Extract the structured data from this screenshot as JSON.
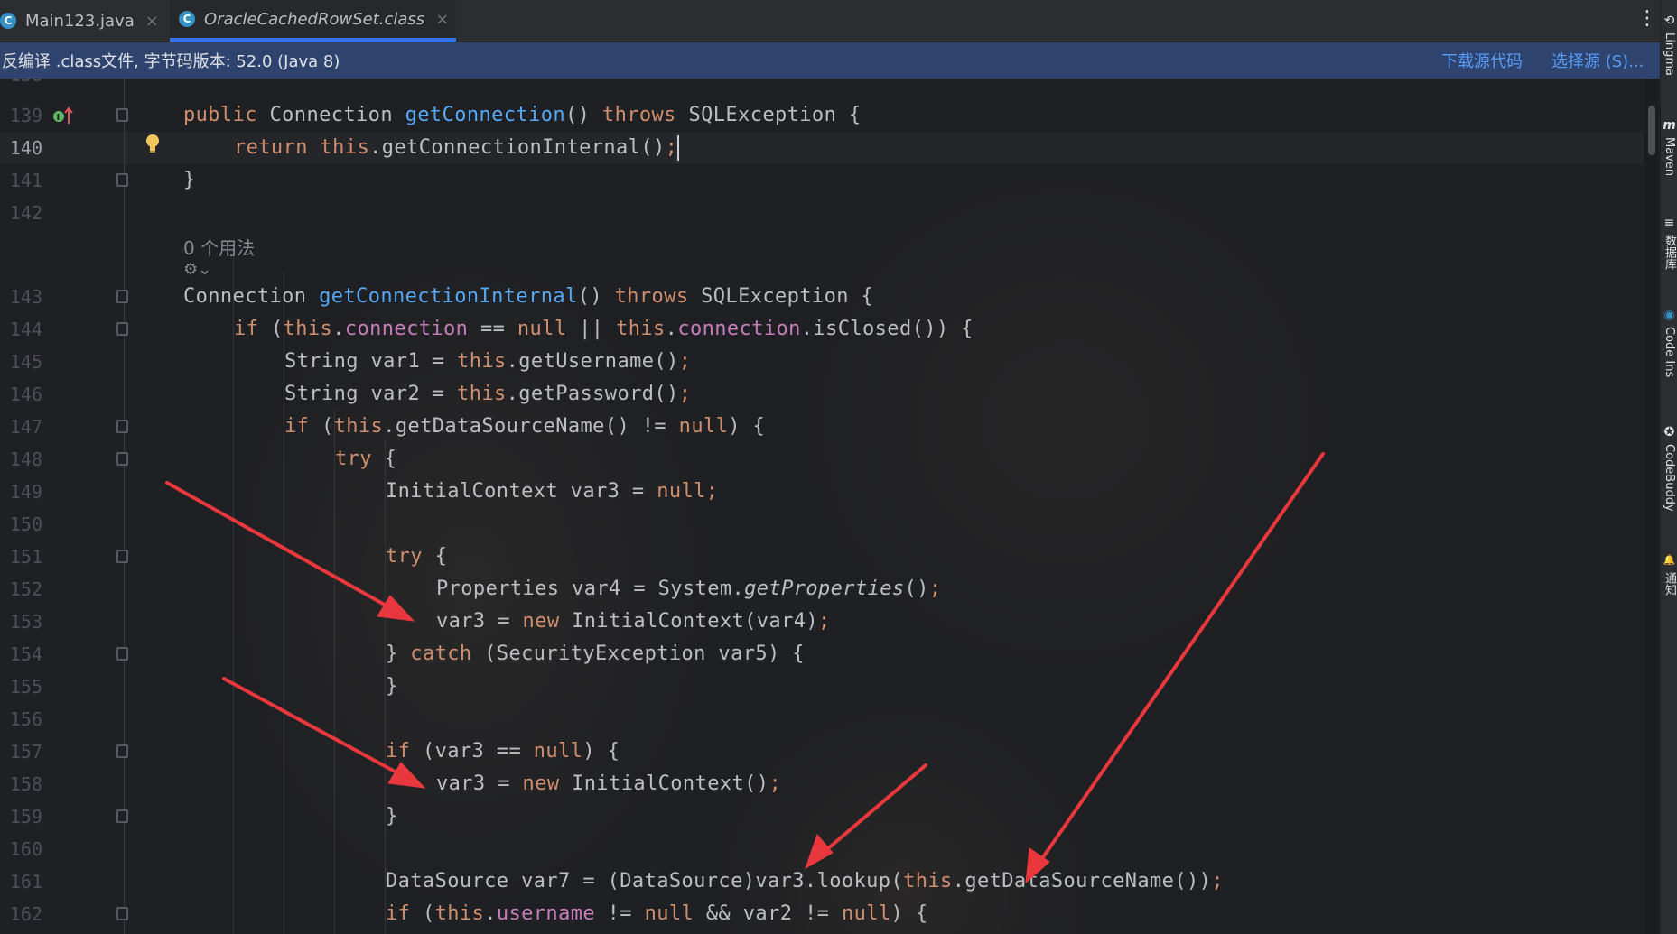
{
  "tabs": [
    {
      "label": "Main123.java",
      "icon": "C",
      "close": "×",
      "active": false
    },
    {
      "label": "OracleCachedRowSet.class",
      "icon": "C",
      "close": "×",
      "active": true
    }
  ],
  "more_icon": "⋮",
  "banner": {
    "message": "反编译 .class文件, 字节码版本: 52.0 (Java 8)",
    "download_link": "下载源代码",
    "choose_source_link": "选择源 (S)..."
  },
  "inlay_hint": {
    "usages": "0 个用法",
    "icons": "⚙⌄"
  },
  "line_numbers": {
    "top_partial": "138",
    "l139": "139",
    "l140": "140",
    "l141": "141",
    "l142": "142",
    "l143": "143",
    "l144": "144",
    "l145": "145",
    "l146": "146",
    "l147": "147",
    "l148": "148",
    "l149": "149",
    "l150": "150",
    "l151": "151",
    "l152": "152",
    "l153": "153",
    "l154": "154",
    "l155": "155",
    "l156": "156",
    "l157": "157",
    "l158": "158",
    "l159": "159",
    "l160": "160",
    "l161": "161",
    "l162": "162"
  },
  "code": {
    "l139": {
      "kw1": "public",
      "t1": " Connection ",
      "fn": "getConnection",
      "t2": "() ",
      "kw2": "throws",
      "t3": " SQLException {"
    },
    "l140": {
      "kw1": "return",
      "sp": " ",
      "kw2": "this",
      "t1": ".getConnectionInternal()",
      "semi": ";"
    },
    "l141": {
      "t1": "}"
    },
    "l143": {
      "t1": "Connection ",
      "fn": "getConnectionInternal",
      "t2": "() ",
      "kw": "throws",
      "t3": " SQLException {"
    },
    "l144": {
      "kw1": "if",
      "t1": " (",
      "kw2": "this",
      "t2": ".",
      "fld1": "connection",
      "t3": " == ",
      "kw3": "null",
      "t4": " || ",
      "kw4": "this",
      "t5": ".",
      "fld2": "connection",
      "t6": ".isClosed()) {"
    },
    "l145": {
      "t1": "String var1 = ",
      "kw": "this",
      "t2": ".getUsername()",
      "semi": ";"
    },
    "l146": {
      "t1": "String var2 = ",
      "kw": "this",
      "t2": ".getPassword()",
      "semi": ";"
    },
    "l147": {
      "kw1": "if",
      "t1": " (",
      "kw2": "this",
      "t2": ".getDataSourceName() != ",
      "kw3": "null",
      "t3": ") {"
    },
    "l148": {
      "kw": "try",
      "t1": " {"
    },
    "l149": {
      "t1": "InitialContext var3 = ",
      "kw": "null",
      "semi": ";"
    },
    "l151": {
      "kw": "try",
      "t1": " {"
    },
    "l152": {
      "t1": "Properties var4 = System.",
      "it": "getProperties",
      "t2": "()",
      "semi": ";"
    },
    "l153": {
      "t1": "var3 = ",
      "kw": "new",
      "t2": " InitialContext(var4)",
      "semi": ";"
    },
    "l154": {
      "t1": "} ",
      "kw": "catch",
      "t2": " (SecurityException var5) {"
    },
    "l155": {
      "t1": "}"
    },
    "l157": {
      "kw1": "if",
      "t1": " (var3 == ",
      "kw2": "null",
      "t2": ") {"
    },
    "l158": {
      "t1": "var3 = ",
      "kw": "new",
      "t2": " InitialContext()",
      "semi": ";"
    },
    "l159": {
      "t1": "}"
    },
    "l161": {
      "t1": "DataSource var7 = (DataSource)var3.lookup(",
      "kw": "this",
      "t2": ".getDataSourceName())",
      "semi": ";"
    },
    "l162": {
      "kw1": "if",
      "t1": " (",
      "kw2": "this",
      "t2": ".",
      "fld": "username",
      "t3": " != ",
      "kw3": "null",
      "t4": " && var2 != ",
      "kw4": "null",
      "t5": ") {"
    }
  },
  "tool_windows": [
    {
      "label": "Lingma",
      "icon": "⟲"
    },
    {
      "label": "Maven",
      "icon": "m"
    },
    {
      "label": "数据库",
      "icon": "≡"
    },
    {
      "label": "Code Ins",
      "icon": "◉"
    },
    {
      "label": "CodeBuddy",
      "icon": "✪"
    },
    {
      "label": "通知",
      "icon": "🔔"
    }
  ],
  "colors": {
    "keyword": "#cf8e6d",
    "method": "#56a8f5",
    "field": "#c77dbb",
    "annotation_arrow": "#e8383d",
    "banner_bg": "#2e436e",
    "active_tab_underline": "#3574f0"
  }
}
